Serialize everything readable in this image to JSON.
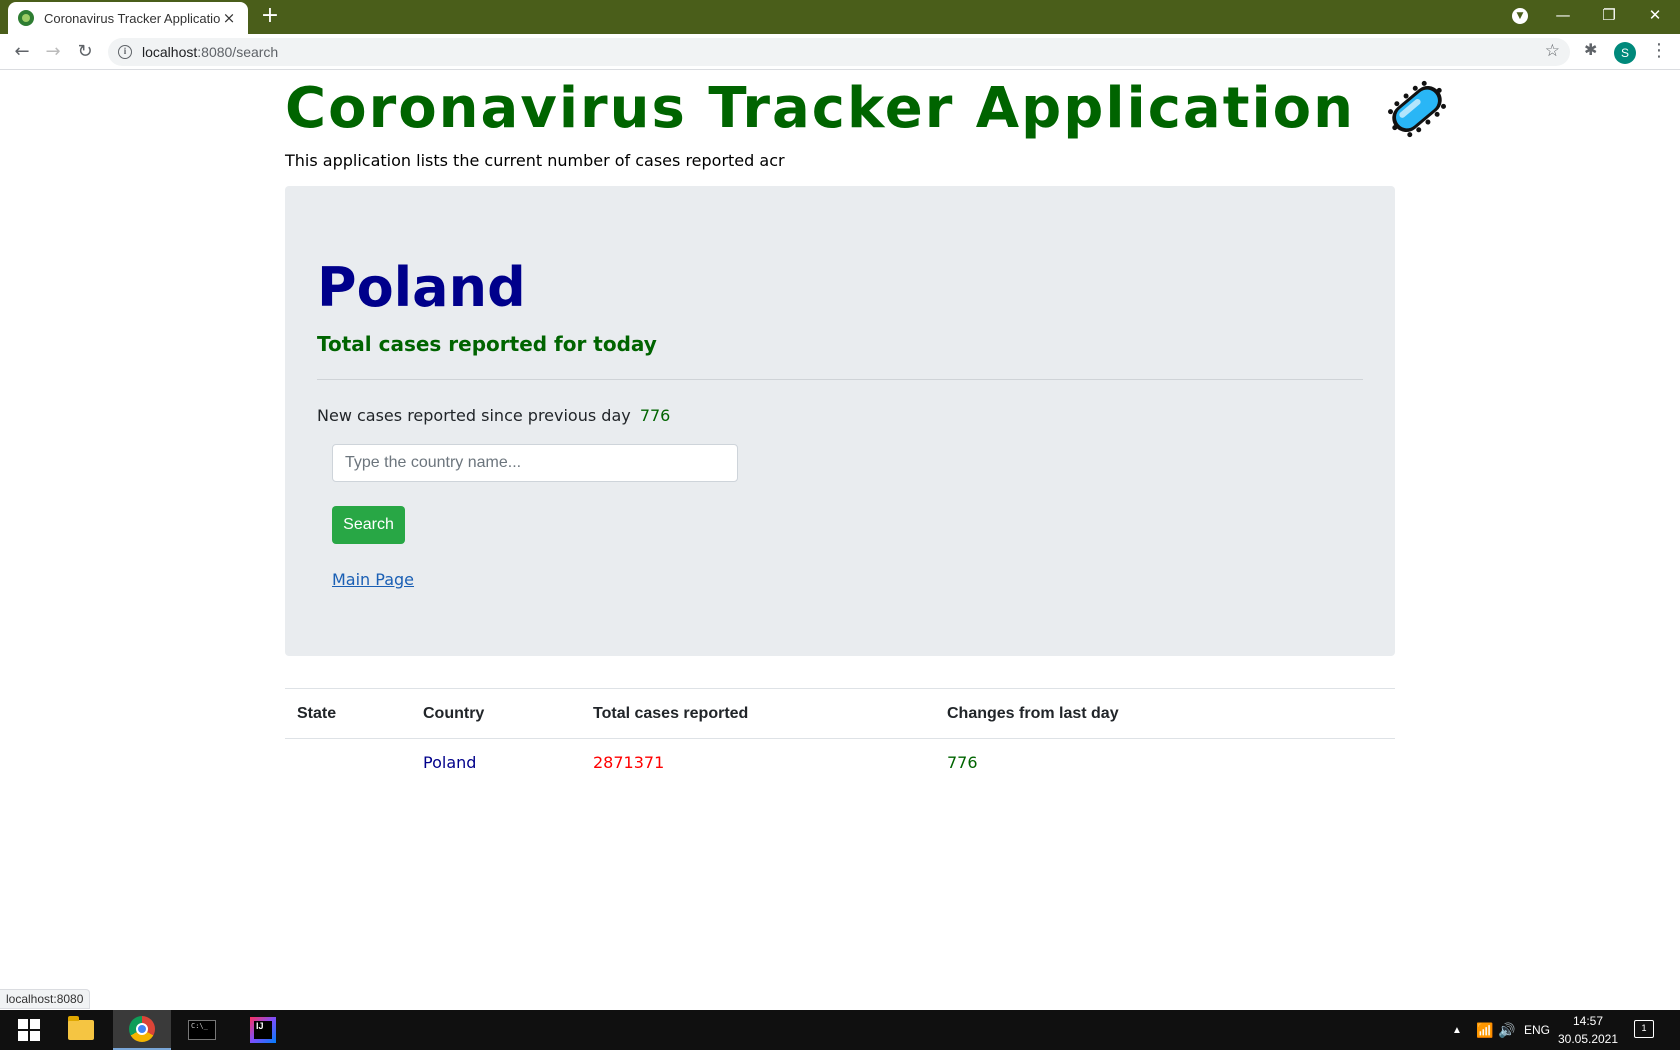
{
  "browser": {
    "tab_title": "Coronavirus Tracker Application",
    "tab_close": "×",
    "new_tab": "+",
    "url_host": "localhost",
    "url_path": ":8080/search",
    "avatar_letter": "S",
    "status_url": "localhost:8080",
    "icons": [
      "back-icon",
      "forward-icon",
      "reload-icon",
      "info-icon",
      "star-icon",
      "extensions-icon",
      "menu-icon"
    ]
  },
  "header": {
    "title": "Coronavirus Tracker Application",
    "subtitle": "This application lists the current number of cases reported acr",
    "title_color": "#006400"
  },
  "jumbotron": {
    "country": "Poland",
    "lead": "Total cases reported for today",
    "new_cases_label": "New cases reported since previous day",
    "new_cases_value": "776",
    "search_placeholder": "Type the country name...",
    "search_button": "Search",
    "main_link": "Main Page"
  },
  "table": {
    "headers": [
      "State",
      "Country",
      "Total cases reported",
      "Changes from last day"
    ],
    "rows": [
      {
        "state": "",
        "country": "Poland",
        "total": "2871371",
        "change": "776"
      }
    ]
  },
  "taskbar": {
    "lang": "ENG",
    "time": "14:57",
    "date": "30.05.2021",
    "notification_count": "1"
  },
  "colors": {
    "tabbar": "#4a5e1a",
    "jumbotron_bg": "#e9ecef",
    "country": "#00008b",
    "total": "#ff0000",
    "change": "#006400",
    "button": "#28a745"
  }
}
